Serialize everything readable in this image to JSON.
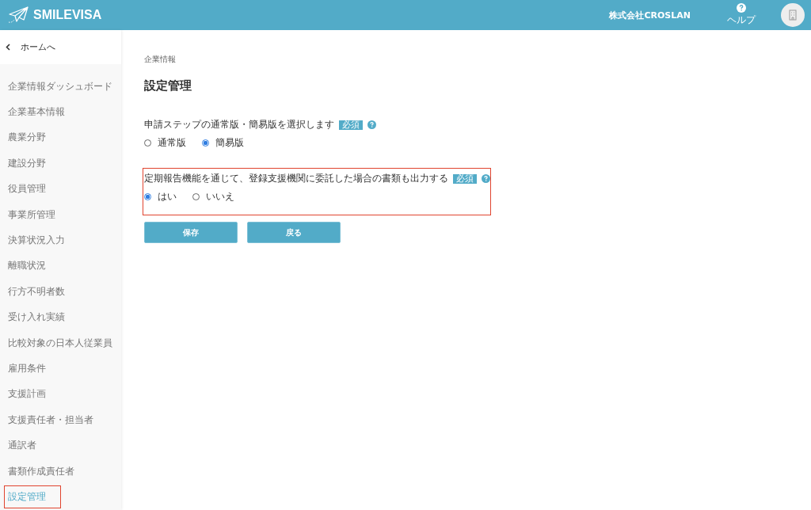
{
  "header": {
    "brand": "SMILEVISA",
    "company": "株式会社CROSLAN",
    "help": "ヘルプ"
  },
  "sidebar": {
    "back": "ホームへ",
    "items": [
      {
        "label": "企業情報ダッシュボード",
        "selected": false,
        "highlighted": false
      },
      {
        "label": "企業基本情報",
        "selected": false,
        "highlighted": false
      },
      {
        "label": "農業分野",
        "selected": false,
        "highlighted": false
      },
      {
        "label": "建設分野",
        "selected": false,
        "highlighted": false
      },
      {
        "label": "役員管理",
        "selected": false,
        "highlighted": false
      },
      {
        "label": "事業所管理",
        "selected": false,
        "highlighted": false
      },
      {
        "label": "決算状況入力",
        "selected": false,
        "highlighted": false
      },
      {
        "label": "離職状況",
        "selected": false,
        "highlighted": false
      },
      {
        "label": "行方不明者数",
        "selected": false,
        "highlighted": false
      },
      {
        "label": "受け入れ実績",
        "selected": false,
        "highlighted": false
      },
      {
        "label": "比較対象の日本人従業員",
        "selected": false,
        "highlighted": false
      },
      {
        "label": "雇用条件",
        "selected": false,
        "highlighted": false
      },
      {
        "label": "支援計画",
        "selected": false,
        "highlighted": false
      },
      {
        "label": "支援責任者・担当者",
        "selected": false,
        "highlighted": false
      },
      {
        "label": "通訳者",
        "selected": false,
        "highlighted": false
      },
      {
        "label": "書類作成責任者",
        "selected": false,
        "highlighted": false
      },
      {
        "label": "設定管理",
        "selected": true,
        "highlighted": true
      }
    ]
  },
  "breadcrumb": "企業情報",
  "title": "設定管理",
  "questions": [
    {
      "label": "申請ステップの通常版・簡易版を選択します",
      "badge": "必須",
      "highlighted": false,
      "options": [
        {
          "label": "通常版",
          "selected": false
        },
        {
          "label": "簡易版",
          "selected": true
        }
      ]
    },
    {
      "label": "定期報告機能を通じて、登録支援機関に委託した場合の書類も出力する",
      "badge": "必須",
      "highlighted": true,
      "options": [
        {
          "label": "はい",
          "selected": true
        },
        {
          "label": "いいえ",
          "selected": false
        }
      ]
    }
  ],
  "buttons": [
    "保存",
    "戻る"
  ]
}
